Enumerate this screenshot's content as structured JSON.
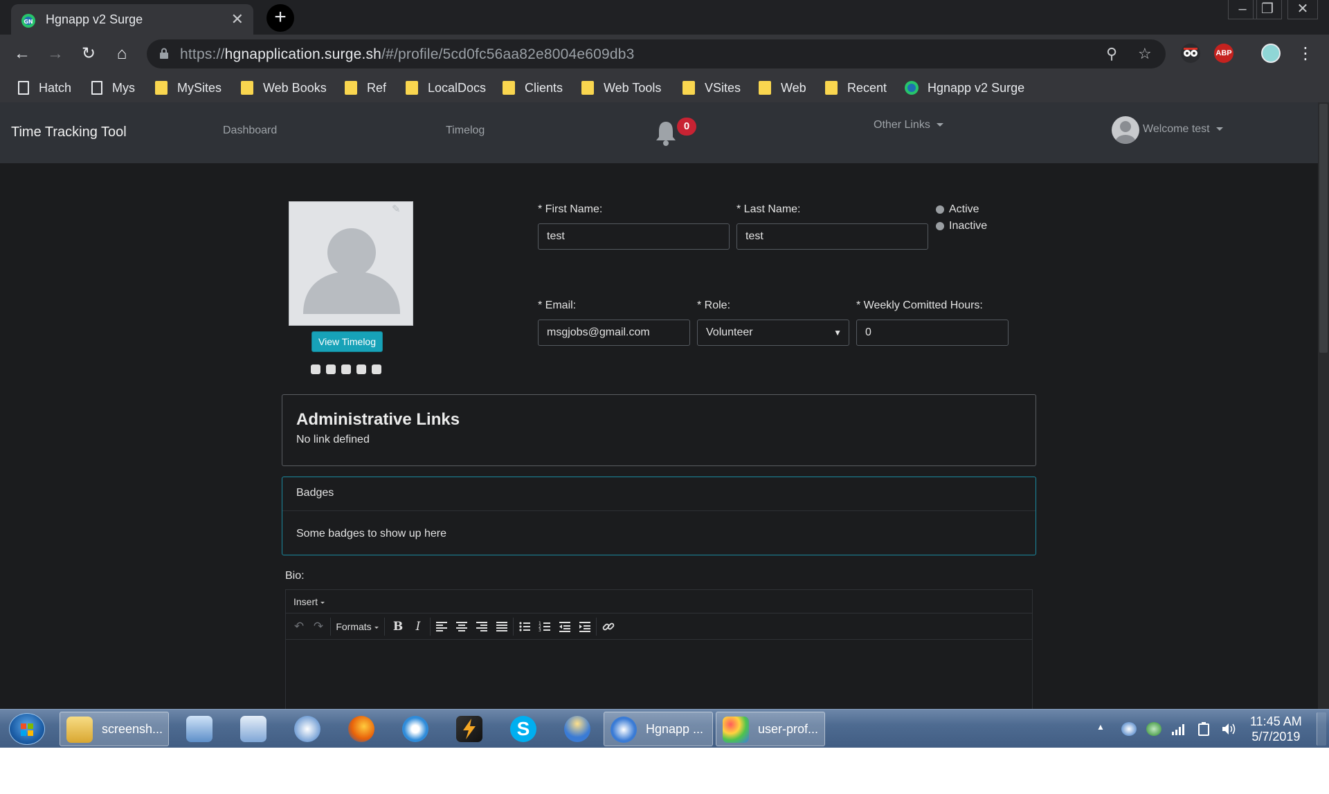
{
  "browser": {
    "tab_title": "Hgnapp v2 Surge",
    "url_scheme": "https://",
    "url_host": "hgnapplication.surge.sh",
    "url_path": "/#/profile/5cd0fc56aa82e8004e609db3",
    "bookmarks": [
      "Hatch",
      "Mys",
      "MySites",
      "Web Books",
      "Ref",
      "LocalDocs",
      "Clients",
      "Web Tools",
      "VSites",
      "Web",
      "Recent",
      "Hgnapp v2 Surge"
    ]
  },
  "app_nav": {
    "brand": "Time Tracking Tool",
    "dashboard": "Dashboard",
    "timelog": "Timelog",
    "notification_count": "0",
    "other_links": "Other Links",
    "welcome": "Welcome test"
  },
  "profile": {
    "view_timelog": "View Timelog",
    "first_name_label": "* First Name:",
    "first_name": "test",
    "last_name_label": "* Last Name:",
    "last_name": "test",
    "status_active": "Active",
    "status_inactive": "Inactive",
    "email_label": "* Email:",
    "email": "msgjobs@gmail.com",
    "role_label": "* Role:",
    "role": "Volunteer",
    "hours_label": "* Weekly Comitted Hours:",
    "hours": "0"
  },
  "admin_links": {
    "title": "Administrative Links",
    "empty": "No link defined"
  },
  "badges": {
    "title": "Badges",
    "body": "Some badges to show up here"
  },
  "bio": {
    "label": "Bio:",
    "menu_insert": "Insert",
    "formats": "Formats",
    "bold": "B",
    "italic": "I"
  },
  "taskbar": {
    "explorer_label": "screensh...",
    "chrome_label": "Hgnapp ...",
    "paint_label": "user-prof...",
    "time": "11:45 AM",
    "date": "5/7/2019"
  },
  "colors": {
    "accent": "#17a2b8",
    "notification": "#c82333",
    "navbar": "#2f3237",
    "background": "#1b1c1e"
  }
}
